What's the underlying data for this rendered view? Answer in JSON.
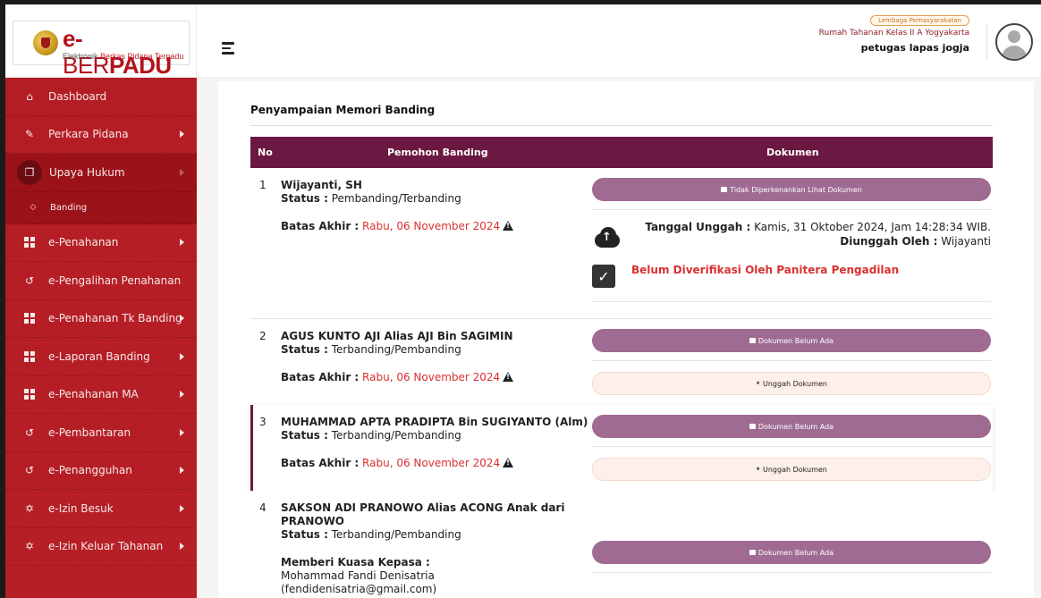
{
  "app": {
    "logo_prefix": "e-",
    "logo_mid": "BER",
    "logo_suffix": "PADU",
    "logo_sub_a": "Elektronik ",
    "logo_sub_b": "Berkas Pidana Terpadu"
  },
  "header": {
    "institution_badge": "Lembaga Pemasyarakatan",
    "institution_name": "Rumah Tahanan Kelas II A Yogyakarta",
    "user_name": "petugas lapas jogja"
  },
  "sidebar": {
    "items": [
      {
        "label": "Dashboard",
        "icon": "home-icon"
      },
      {
        "label": "Perkara Pidana",
        "icon": "edit-icon"
      },
      {
        "label": "Upaya Hukum",
        "icon": "copy-icon"
      },
      {
        "label": "Banding",
        "icon": "diamond-icon"
      },
      {
        "label": "e-Penahanan",
        "icon": "grid-icon"
      },
      {
        "label": "e-Pengalihan Penahanan",
        "icon": "history-icon"
      },
      {
        "label": "e-Penahanan Tk Banding",
        "icon": "grid-icon"
      },
      {
        "label": "e-Laporan Banding",
        "icon": "grid-icon"
      },
      {
        "label": "e-Penahanan MA",
        "icon": "grid-icon"
      },
      {
        "label": "e-Pembantaran",
        "icon": "history-icon"
      },
      {
        "label": "e-Penangguhan",
        "icon": "history-icon"
      },
      {
        "label": "e-Izin Besuk",
        "icon": "handshake-icon"
      },
      {
        "label": "e-Izin Keluar Tahanan",
        "icon": "handshake-icon"
      }
    ]
  },
  "main": {
    "title": "Penyampaian Memori Banding",
    "columns": {
      "no": "No",
      "pemohon": "Pemohon Banding",
      "dokumen": "Dokumen"
    },
    "labels": {
      "status": "Status :",
      "batas": "Batas Akhir :",
      "tanggal_unggah": "Tanggal Unggah :",
      "diunggah_oleh": "Diunggah Oleh :",
      "kuasa": "Memberi Kuasa Kepasa :"
    },
    "rows": [
      {
        "no": "1",
        "name": "Wijayanti, SH",
        "status": "Pembanding/Terbanding",
        "deadline": "Rabu, 06 November 2024",
        "doc_button": "Tidak Diperkenankan Lihat Dokumen",
        "upload_date": "Kamis, 31 Oktober 2024, Jam 14:28:34 WIB.",
        "uploaded_by": "Wijayanti",
        "verification": "Belum Diverifikasi Oleh Panitera Pengadilan"
      },
      {
        "no": "2",
        "name": "AGUS KUNTO AJI Alias AJI Bin SAGIMIN",
        "status": "Terbanding/Pembanding",
        "deadline": "Rabu, 06 November 2024",
        "doc_button": "Dokumen Belum Ada",
        "upload_button": "Unggah Dokumen"
      },
      {
        "no": "3",
        "name": "MUHAMMAD APTA PRADIPTA Bin SUGIYANTO (Alm)",
        "status": "Terbanding/Pembanding",
        "deadline": "Rabu, 06 November 2024",
        "doc_button": "Dokumen Belum Ada",
        "upload_button": "Unggah Dokumen"
      },
      {
        "no": "4",
        "name_line1": "SAKSON ADI PRANOWO Alias ACONG Anak dari",
        "name_line2": "PRANOWO",
        "status": "Terbanding/Pembanding",
        "kuasa_name": "Mohammad Fandi Denisatria",
        "kuasa_email": "(fendidenisatria@gmail.com)",
        "doc_button": "Dokumen Belum Ada"
      }
    ]
  },
  "colors": {
    "sidebar": "#b71f26",
    "table_header": "#6b1842",
    "doc_button": "#9f6b93",
    "deadline_red": "#d93131"
  }
}
